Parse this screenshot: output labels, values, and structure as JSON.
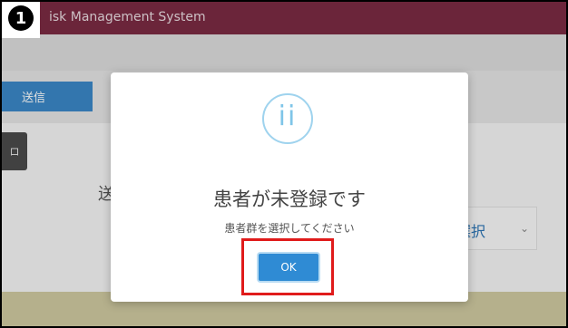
{
  "header": {
    "app_title": "isk Management System",
    "step_badge": "1"
  },
  "toolbar": {
    "send_label": "送信"
  },
  "background": {
    "side_tab_label": "ロ",
    "heading": "送",
    "select_text": "選択",
    "select_chevron": "⌄"
  },
  "dialog": {
    "icon_glyph": "ii",
    "title": "患者が未登録です",
    "message": "患者群を選択してください",
    "ok_label": "OK"
  },
  "colors": {
    "titlebar": "#7a2b43",
    "primary_button": "#2f8bd4",
    "highlight": "#e01b1b",
    "info_icon": "#9fd3ee"
  }
}
